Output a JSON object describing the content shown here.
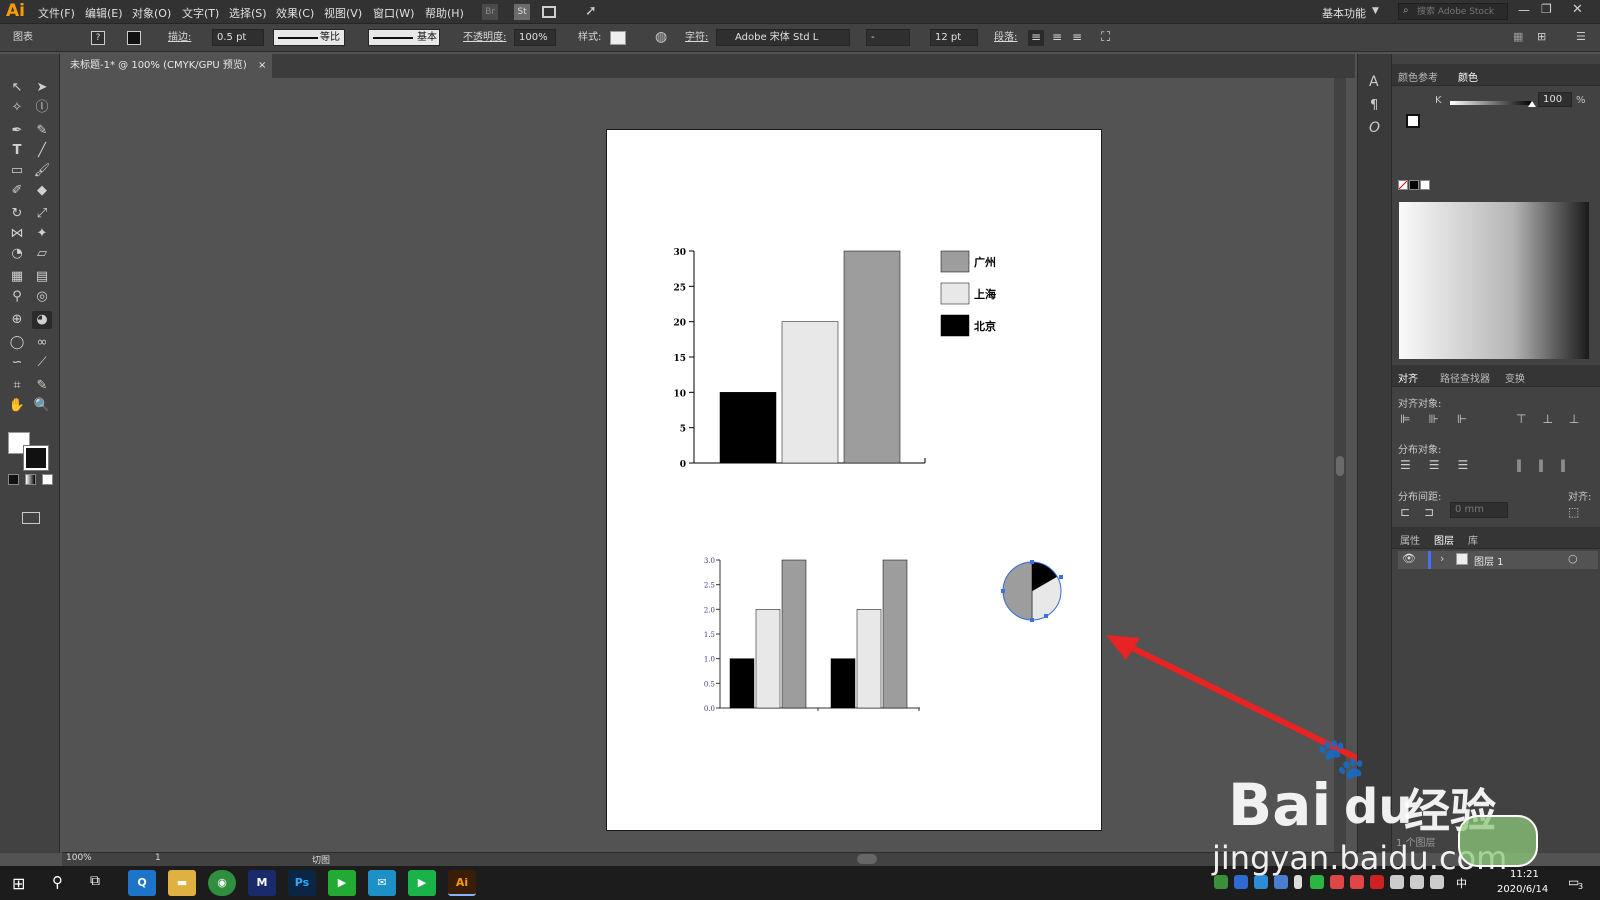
{
  "app": {
    "logo": "Ai"
  },
  "menubar": {
    "items": [
      "文件(F)",
      "编辑(E)",
      "对象(O)",
      "文字(T)",
      "选择(S)",
      "效果(C)",
      "视图(V)",
      "窗口(W)",
      "帮助(H)"
    ],
    "bridge_label": "Br",
    "stock_label": "St",
    "workspace": "基本功能",
    "search_placeholder": "搜索 Adobe Stock"
  },
  "control_bar": {
    "object_type": "图表",
    "stroke_label": "描边:",
    "stroke_weight": "0.5 pt",
    "stroke_profile": "等比",
    "brush_def": "基本",
    "opacity_label": "不透明度:",
    "opacity_value": "100%",
    "style_label": "样式:",
    "char_label": "字符:",
    "font_family": "Adobe 宋体 Std L",
    "font_style": "-",
    "font_size": "12 pt",
    "paragraph_label": "段落:"
  },
  "document": {
    "tab_title": "未标题-1* @ 100% (CMYK/GPU 预览)"
  },
  "chart_data": [
    {
      "type": "bar",
      "categories": [
        "北京",
        "上海",
        "广州"
      ],
      "values": [
        10,
        20,
        30
      ],
      "colors": [
        "#000000",
        "#e8e8e8",
        "#9d9d9d"
      ],
      "yticks": [
        "0",
        "5",
        "10",
        "15",
        "20",
        "25",
        "30"
      ],
      "ylim": [
        0,
        30
      ],
      "legend": [
        {
          "label": "广州",
          "color": "#9d9d9d"
        },
        {
          "label": "上海",
          "color": "#e8e8e8"
        },
        {
          "label": "北京",
          "color": "#000000"
        }
      ],
      "legend_position": "top-right"
    },
    {
      "type": "bar",
      "groups": 2,
      "series": [
        {
          "values": [
            1,
            1
          ],
          "color": "#000000"
        },
        {
          "values": [
            2,
            2
          ],
          "color": "#e8e8e8"
        },
        {
          "values": [
            3,
            3
          ],
          "color": "#9d9d9d"
        }
      ],
      "yticks": [
        "0.0",
        "0.5",
        "1.0",
        "1.5",
        "2.0",
        "2.5",
        "3.0"
      ],
      "ylim": [
        0,
        3
      ]
    },
    {
      "type": "pie",
      "values": [
        1,
        2,
        3
      ],
      "colors": [
        "#000000",
        "#e8e8e8",
        "#9d9d9d"
      ]
    }
  ],
  "panels": {
    "color_guide_tab": "颜色参考",
    "color_tab": "颜色",
    "k_label": "K",
    "k_value": "100",
    "percent": "%",
    "align_tab": "对齐",
    "pathfinder_tab": "路径查找器",
    "transform_tab": "变换",
    "align_objects_label": "对齐对象:",
    "distribute_objects_label": "分布对象:",
    "distribute_spacing_label": "分布间距:",
    "align_to_label": "对齐:",
    "spacing_value": "0 mm",
    "properties_tab": "属性",
    "layers_tab": "图层",
    "libraries_tab": "库",
    "layer_name": "图层 1",
    "layer_count": "1 个图层"
  },
  "statusbar": {
    "zoom": "100%",
    "artboard_number": "1",
    "tool_status": "切图"
  },
  "taskbar": {
    "time": "11:21",
    "date": "2020/6/14",
    "ime": "中",
    "notifications": "3"
  },
  "watermark": {
    "brand": "Bai",
    "brand_du": "du",
    "brand_cn": "经验",
    "url": "jingyan.baidu.com"
  }
}
